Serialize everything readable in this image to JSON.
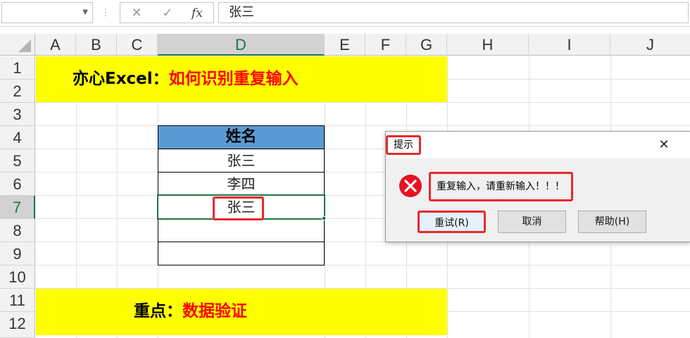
{
  "formula_bar": {
    "name_box_value": "",
    "cancel_glyph": "✕",
    "enter_glyph": "✓",
    "fx_glyph": "fx",
    "content": "张三"
  },
  "columns": [
    "A",
    "B",
    "C",
    "D",
    "E",
    "F",
    "G",
    "H",
    "I",
    "J"
  ],
  "rows": [
    "1",
    "2",
    "3",
    "4",
    "5",
    "6",
    "7",
    "8",
    "9",
    "10",
    "11",
    "12"
  ],
  "active_cell": {
    "column": "D",
    "row": "7"
  },
  "banner_top": {
    "prefix": "亦心Excel：",
    "highlight": "如何识别重复输入"
  },
  "banner_bottom": {
    "prefix": "重点：",
    "highlight": "数据验证"
  },
  "table": {
    "header": "姓名",
    "cells": [
      "张三",
      "李四",
      "张三",
      "",
      ""
    ]
  },
  "dialog": {
    "title": "提示",
    "close_glyph": "✕",
    "message": "重复输入，请重新输入！！！",
    "buttons": {
      "retry": "重试(R)",
      "cancel": "取消",
      "help": "帮助(H)"
    }
  },
  "colors": {
    "banner": "#ffff00",
    "highlight_text": "#ff0000",
    "header_fill": "#5b9bd5",
    "annotation": "#e8292d",
    "selection": "#217346"
  }
}
